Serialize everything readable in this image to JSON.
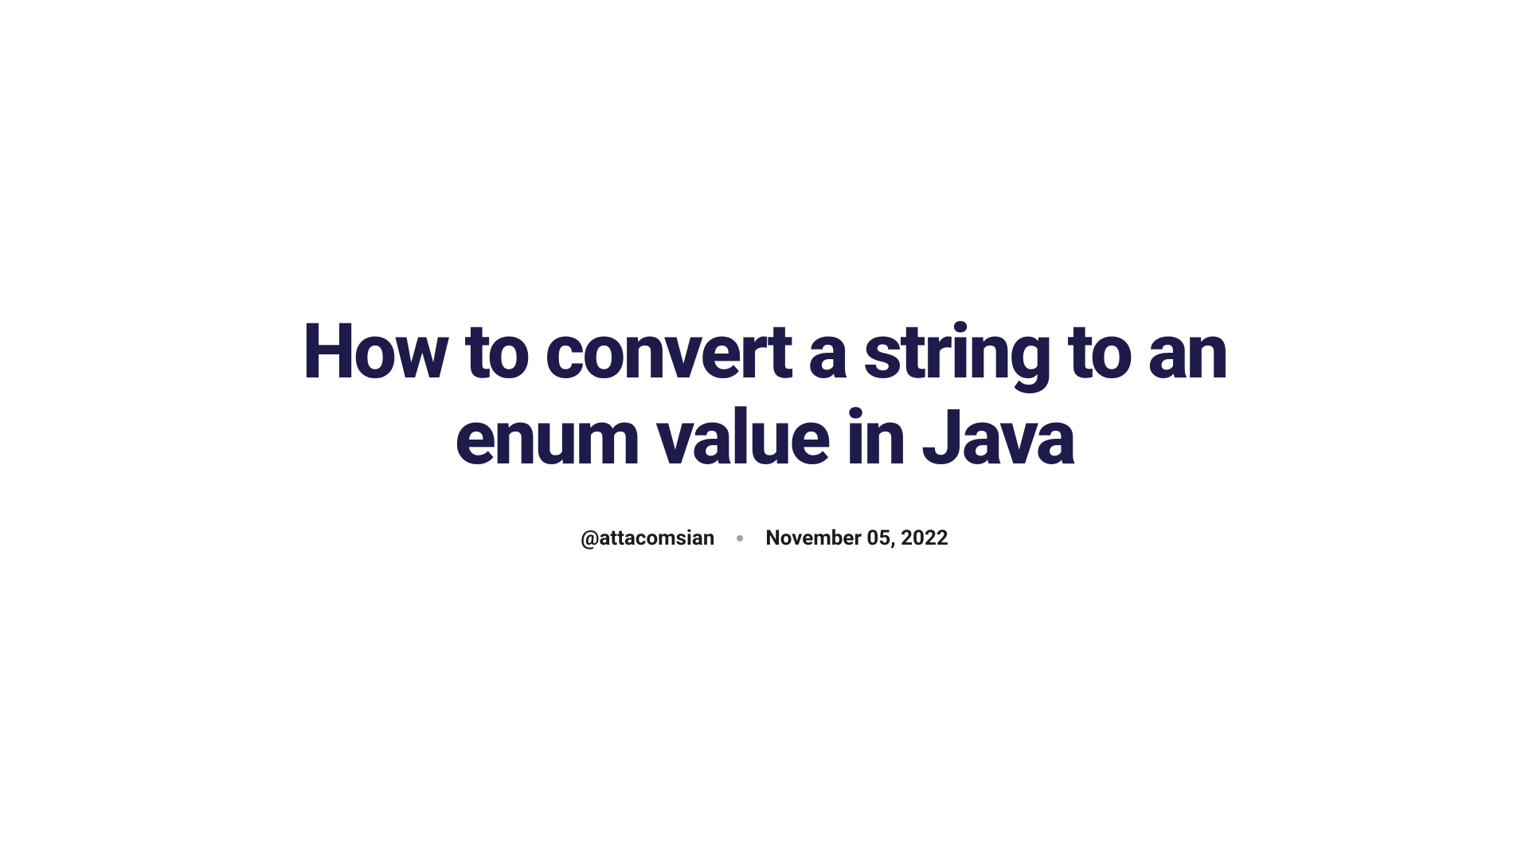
{
  "article": {
    "title": "How to convert a string to an enum value in Java",
    "author": "@attacomsian",
    "date": "November 05, 2022"
  }
}
